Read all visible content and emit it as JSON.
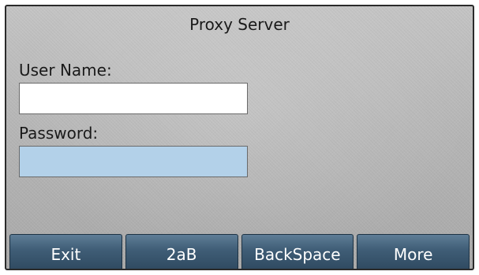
{
  "screen": {
    "title": "Proxy Server"
  },
  "form": {
    "username_label": "User Name:",
    "username_value": "",
    "password_label": "Password:",
    "password_value": ""
  },
  "softkeys": [
    {
      "label": "Exit"
    },
    {
      "label": "2aB"
    },
    {
      "label": "BackSpace"
    },
    {
      "label": "More"
    }
  ],
  "colors": {
    "focused_field": "#b3d1e9",
    "softkey_bar": "#3f5d76"
  }
}
